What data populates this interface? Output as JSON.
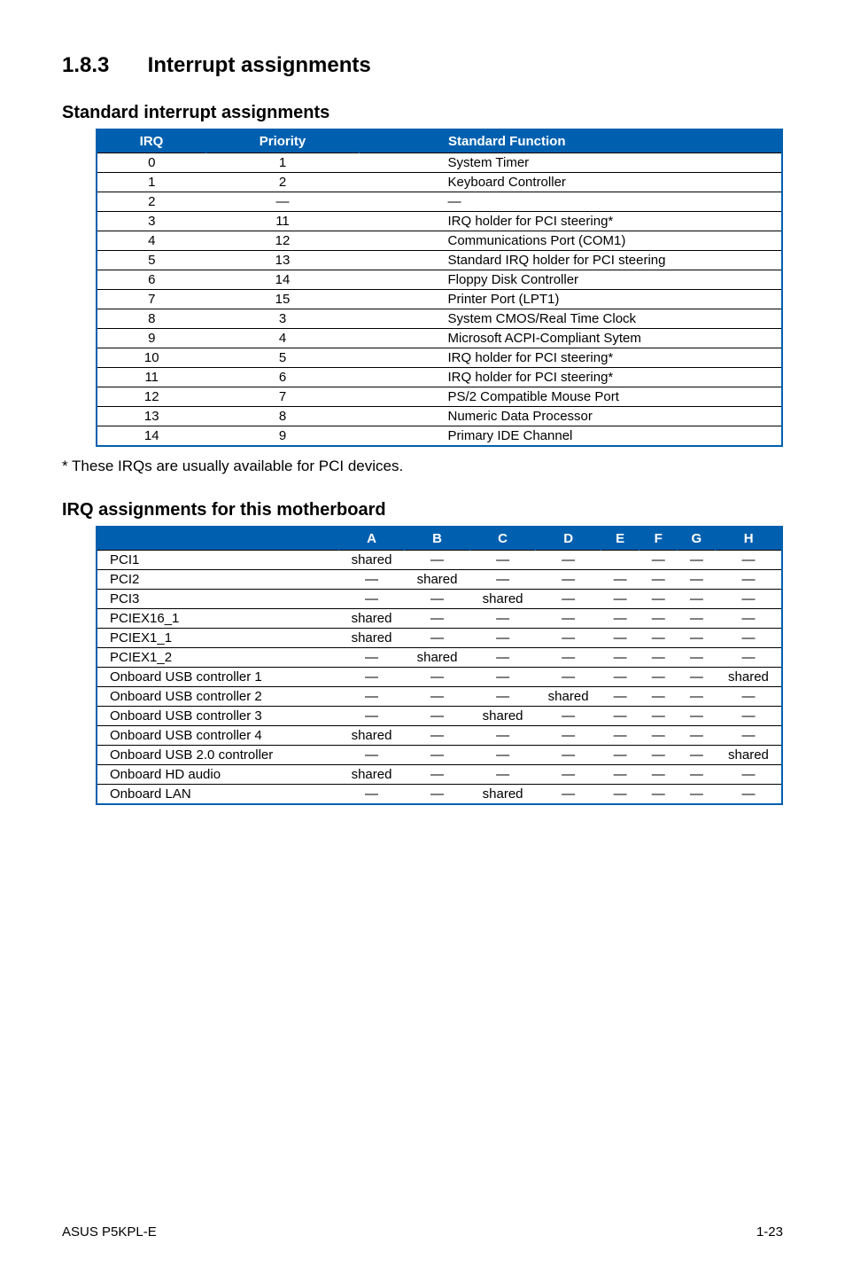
{
  "section": {
    "number": "1.8.3",
    "title": "Interrupt assignments"
  },
  "standard": {
    "heading": "Standard interrupt assignments",
    "headers": {
      "irq": "IRQ",
      "priority": "Priority",
      "fn": "Standard Function"
    },
    "rows": [
      {
        "irq": "0",
        "priority": "1",
        "fn": "System Timer"
      },
      {
        "irq": "1",
        "priority": "2",
        "fn": "Keyboard Controller"
      },
      {
        "irq": "2",
        "priority": "—",
        "fn": "—"
      },
      {
        "irq": "3",
        "priority": "11",
        "fn": "IRQ holder for PCI steering*"
      },
      {
        "irq": "4",
        "priority": "12",
        "fn": "Communications Port (COM1)"
      },
      {
        "irq": "5",
        "priority": "13",
        "fn": "Standard IRQ holder for PCI steering"
      },
      {
        "irq": "6",
        "priority": "14",
        "fn": "Floppy Disk Controller"
      },
      {
        "irq": "7",
        "priority": "15",
        "fn": "Printer Port (LPT1)"
      },
      {
        "irq": "8",
        "priority": "3",
        "fn": "System CMOS/Real Time Clock"
      },
      {
        "irq": "9",
        "priority": "4",
        "fn": "Microsoft ACPI-Compliant Sytem"
      },
      {
        "irq": "10",
        "priority": "5",
        "fn": "IRQ holder for PCI steering*"
      },
      {
        "irq": "11",
        "priority": "6",
        "fn": "IRQ holder for PCI steering*"
      },
      {
        "irq": "12",
        "priority": "7",
        "fn": "PS/2 Compatible Mouse Port"
      },
      {
        "irq": "13",
        "priority": "8",
        "fn": "Numeric Data Processor"
      },
      {
        "irq": "14",
        "priority": "9",
        "fn": "Primary IDE Channel"
      }
    ],
    "footnote": "* These IRQs are usually available for PCI devices."
  },
  "irq": {
    "heading": "IRQ assignments for this motherboard",
    "cols": [
      "A",
      "B",
      "C",
      "D",
      "E",
      "F",
      "G",
      "H"
    ],
    "rows": [
      {
        "label": "PCI1",
        "cells": [
          "shared",
          "—",
          "—",
          "—",
          "",
          "—",
          "—",
          "—"
        ]
      },
      {
        "label": "PCI2",
        "cells": [
          "—",
          "shared",
          "—",
          "—",
          "—",
          "—",
          "—",
          "—"
        ]
      },
      {
        "label": "PCI3",
        "cells": [
          "—",
          "—",
          "shared",
          "—",
          "—",
          "—",
          "—",
          "—"
        ]
      },
      {
        "label": "PCIEX16_1",
        "cells": [
          "shared",
          "—",
          "—",
          "—",
          "—",
          "—",
          "—",
          "—"
        ]
      },
      {
        "label": "PCIEX1_1",
        "cells": [
          "shared",
          "—",
          "—",
          "—",
          "—",
          "—",
          "—",
          "—"
        ]
      },
      {
        "label": "PCIEX1_2",
        "cells": [
          "—",
          "shared",
          "—",
          "—",
          "—",
          "—",
          "—",
          "—"
        ]
      },
      {
        "label": "Onboard USB controller 1",
        "cells": [
          "—",
          "—",
          "—",
          "—",
          "—",
          "—",
          "—",
          "shared"
        ]
      },
      {
        "label": "Onboard USB controller 2",
        "cells": [
          "—",
          "—",
          "—",
          "shared",
          "—",
          "—",
          "—",
          "—"
        ]
      },
      {
        "label": "Onboard USB controller 3",
        "cells": [
          "—",
          "—",
          "shared",
          "—",
          "—",
          "—",
          "—",
          "—"
        ]
      },
      {
        "label": "Onboard USB controller 4",
        "cells": [
          "shared",
          "—",
          "—",
          "—",
          "—",
          "—",
          "—",
          "—"
        ]
      },
      {
        "label": "Onboard USB 2.0 controller",
        "cells": [
          "—",
          "—",
          "—",
          "—",
          "—",
          "—",
          "—",
          "shared"
        ]
      },
      {
        "label": "Onboard HD audio",
        "cells": [
          "shared",
          "—",
          "—",
          "—",
          "—",
          "—",
          "—",
          "—"
        ]
      },
      {
        "label": "Onboard LAN",
        "cells": [
          "—",
          "—",
          "shared",
          "—",
          "—",
          "—",
          "—",
          "—"
        ]
      }
    ]
  },
  "footer": {
    "left": "ASUS P5KPL-E",
    "right": "1-23"
  }
}
